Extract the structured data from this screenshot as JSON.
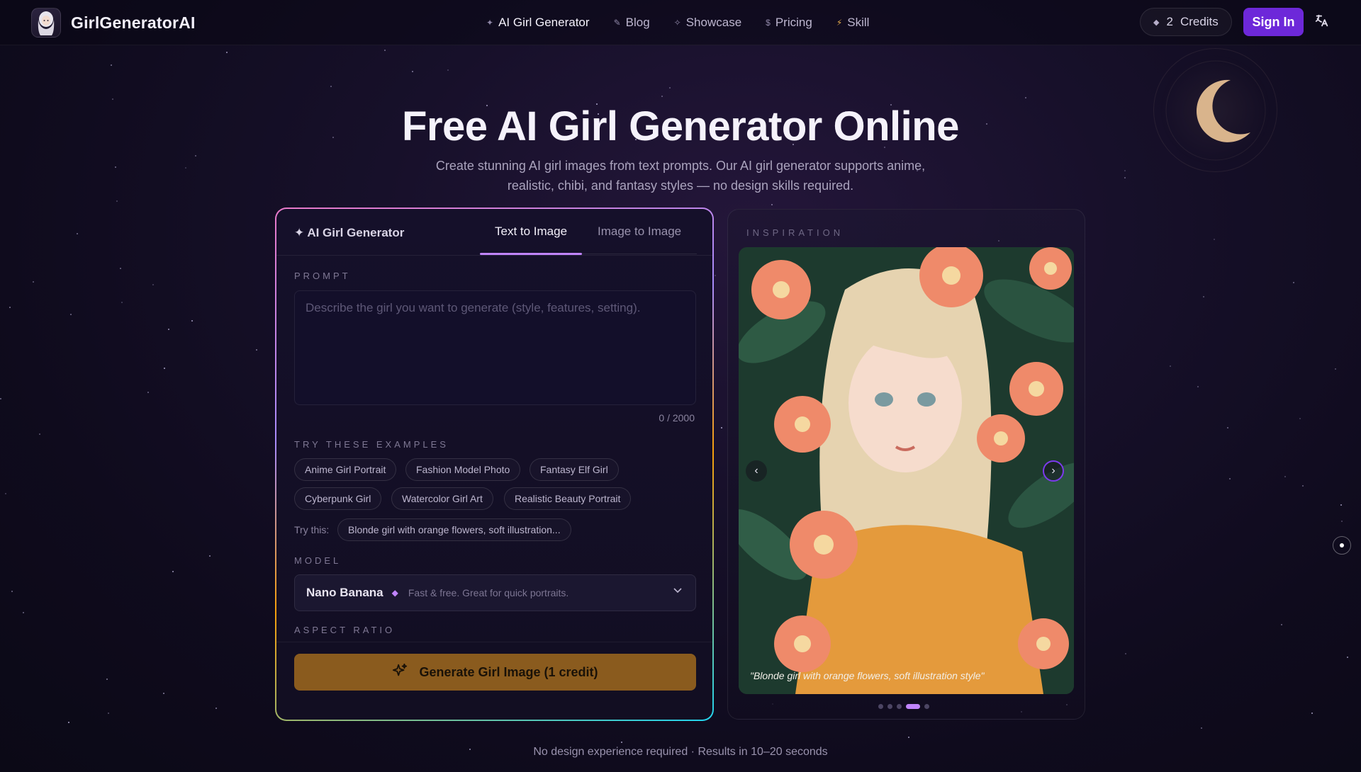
{
  "header": {
    "brand": "GirlGeneratorAI",
    "nav": [
      {
        "icon": "✦",
        "label": "AI Girl Generator"
      },
      {
        "icon": "✎",
        "label": "Blog"
      },
      {
        "icon": "✧",
        "label": "Showcase"
      },
      {
        "icon": "$",
        "label": "Pricing"
      },
      {
        "icon": "⚡",
        "label": "Skill"
      }
    ],
    "credits_count": "2",
    "credits_label": "Credits",
    "sign_in": "Sign In",
    "lang_icon": "文A"
  },
  "hero": {
    "title": "Free AI Girl Generator Online",
    "subtitle": "Create stunning AI girl images from text prompts. Our AI girl generator supports anime, realistic, chibi, and fantasy styles — no design skills required."
  },
  "generator": {
    "title": "✦ AI Girl Generator",
    "tabs": [
      "Text to Image",
      "Image to Image"
    ],
    "prompt_label": "PROMPT",
    "prompt_placeholder": "Describe the girl you want to generate (style, features, setting).",
    "prompt_value": "",
    "counter": "0 / 2000",
    "examples_label": "TRY THESE EXAMPLES",
    "examples": [
      "Anime Girl Portrait",
      "Fashion Model Photo",
      "Fantasy Elf Girl",
      "Cyberpunk Girl",
      "Watercolor Girl Art",
      "Realistic Beauty Portrait"
    ],
    "try_label": "Try this:",
    "try_chip": "Blonde girl with orange flowers, soft illustration...",
    "model_label": "MODEL",
    "model_name": "Nano Banana",
    "model_desc": "Fast & free. Great for quick portraits.",
    "aspect_label": "ASPECT RATIO",
    "generate_button": "Generate Girl Image (1 credit)"
  },
  "inspiration": {
    "label": "INSPIRATION",
    "caption": "\"Blonde girl with orange flowers, soft illustration style\"",
    "arrow_prev": "‹",
    "arrow_next": "›",
    "slide_count": 5,
    "active_slide": 4
  },
  "footer": {
    "note": "No design experience required · Results in 10–20 seconds"
  },
  "colors": {
    "accent": "#6d28d9",
    "generate_button": "#8a5b1e",
    "tab_underline": "#c084fc"
  }
}
